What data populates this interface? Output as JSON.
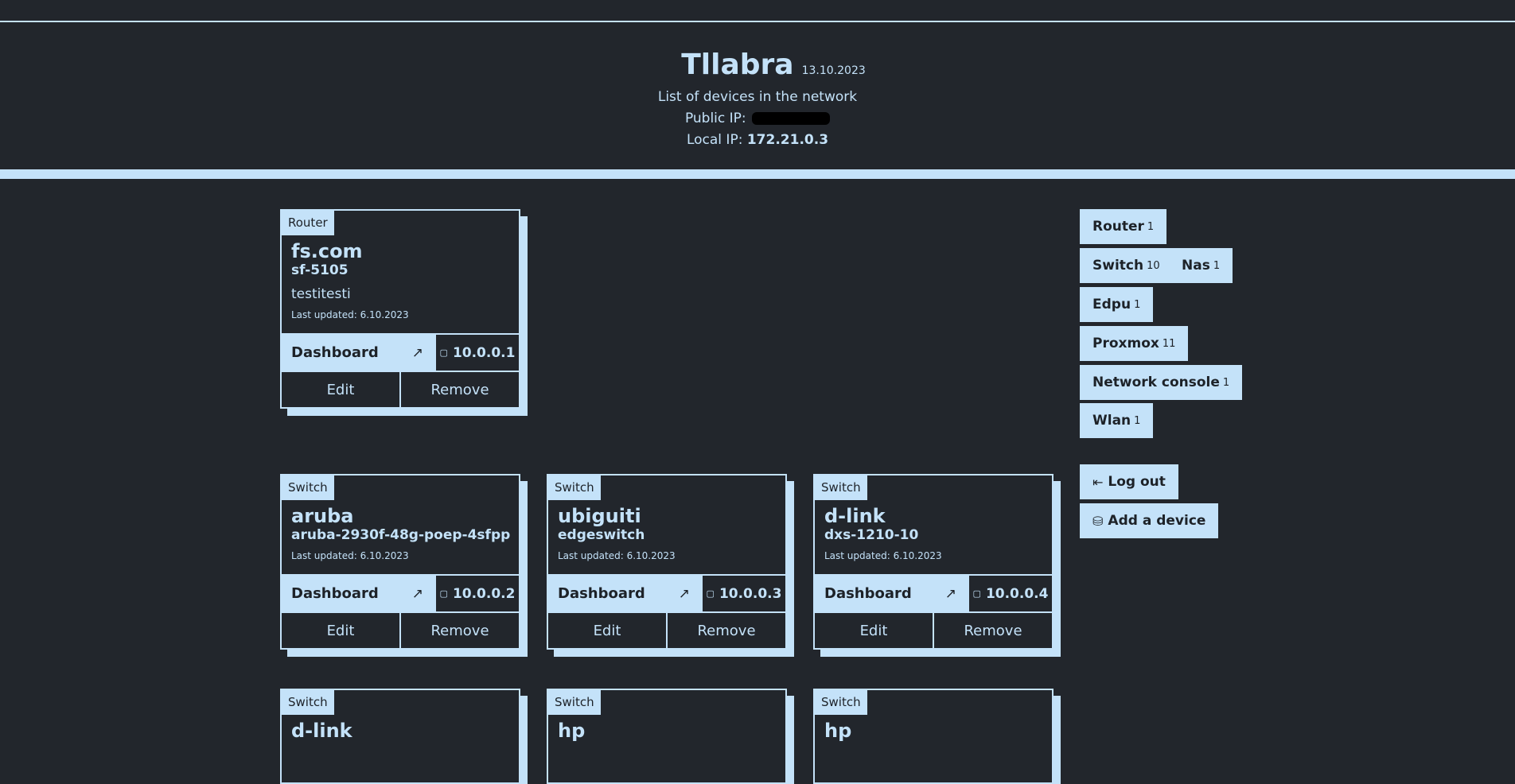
{
  "header": {
    "title": "Tllabra",
    "date": "13.10.2023",
    "subtitle": "List of devices in the network",
    "public_ip_label": "Public IP:",
    "local_ip_label": "Local IP:",
    "local_ip": "172.21.0.3"
  },
  "devices": [
    {
      "type": "Router",
      "brand": "fs.com",
      "model": "sf-5105",
      "description": "testitesti",
      "updated": "Last updated: 6.10.2023",
      "dashboard": "Dashboard",
      "ip": "10.0.0.1",
      "edit": "Edit",
      "remove": "Remove"
    },
    {
      "type": "Switch",
      "brand": "aruba",
      "model": "aruba-2930f-48g-poep-4sfpp",
      "updated": "Last updated: 6.10.2023",
      "dashboard": "Dashboard",
      "ip": "10.0.0.2",
      "edit": "Edit",
      "remove": "Remove"
    },
    {
      "type": "Switch",
      "brand": "ubiguiti",
      "model": "edgeswitch",
      "updated": "Last updated: 6.10.2023",
      "dashboard": "Dashboard",
      "ip": "10.0.0.3",
      "edit": "Edit",
      "remove": "Remove"
    },
    {
      "type": "Switch",
      "brand": "d-link",
      "model": "dxs-1210-10",
      "updated": "Last updated: 6.10.2023",
      "dashboard": "Dashboard",
      "ip": "10.0.0.4",
      "edit": "Edit",
      "remove": "Remove"
    },
    {
      "type": "Switch",
      "brand": "d-link"
    },
    {
      "type": "Switch",
      "brand": "hp"
    },
    {
      "type": "Switch",
      "brand": "hp"
    }
  ],
  "icons": {
    "dashboard": "arrow-up-right-icon",
    "ip": "clipboard-icon",
    "logout": "logout-icon",
    "add": "database-add-icon"
  },
  "filters": [
    {
      "label": "Router",
      "count": "1"
    },
    {
      "label": "Switch",
      "count": "10"
    },
    {
      "label": "Nas",
      "count": "1"
    },
    {
      "label": "Edpu",
      "count": "1"
    },
    {
      "label": "Proxmox",
      "count": "11"
    },
    {
      "label": "Network console",
      "count": "1"
    },
    {
      "label": "Wlan",
      "count": "1"
    }
  ],
  "actions": {
    "logout": "Log out",
    "add_device": "Add a device"
  },
  "colors": {
    "background": "#22262c",
    "accent": "#c4e2f9",
    "dark_text": "#1d2228"
  }
}
